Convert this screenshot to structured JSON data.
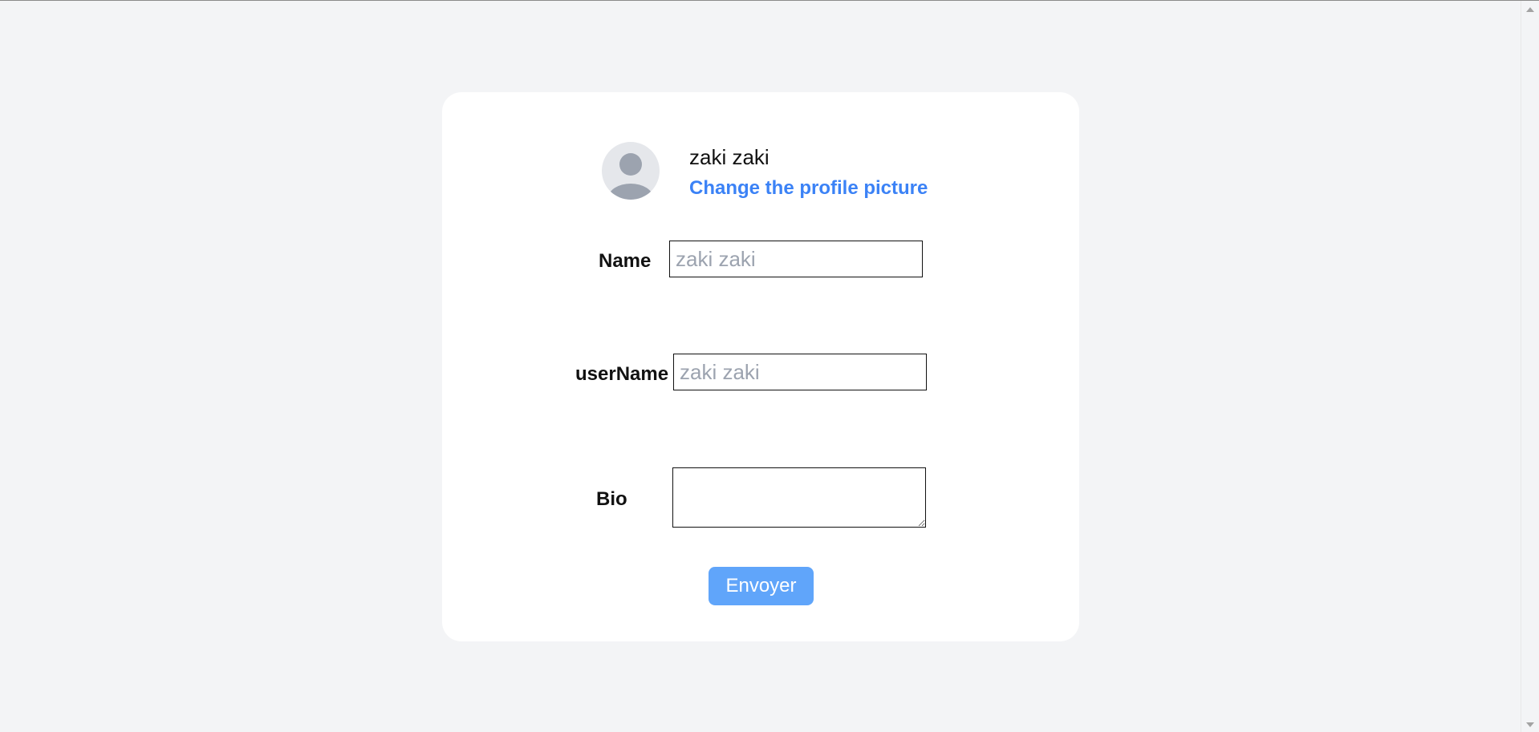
{
  "profile": {
    "display_name": "zaki zaki",
    "change_picture_label": "Change the profile picture",
    "avatar_icon": "user-silhouette-icon"
  },
  "form": {
    "name": {
      "label": "Name",
      "value": "",
      "placeholder": "zaki zaki"
    },
    "username": {
      "label": "userName",
      "value": "",
      "placeholder": "zaki zaki"
    },
    "bio": {
      "label": "Bio",
      "value": "",
      "placeholder": ""
    },
    "submit_label": "Envoyer"
  },
  "colors": {
    "page_background": "#f3f4f6",
    "card_background": "#ffffff",
    "link": "#3b82f6",
    "button": "#60a5fa",
    "placeholder": "#9ca3af"
  }
}
